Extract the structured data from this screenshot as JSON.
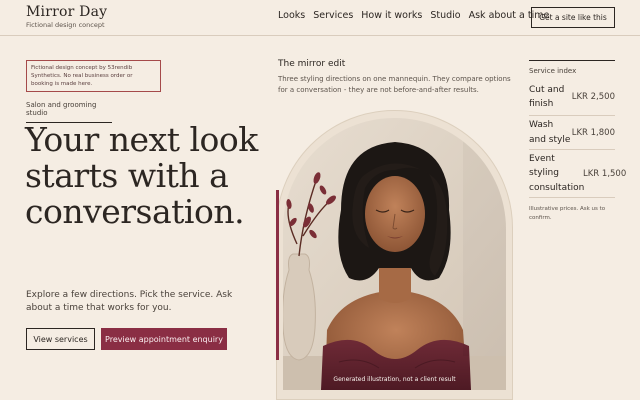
{
  "header": {
    "brand_name": "Mirror Day",
    "brand_sub": "Fictional design concept",
    "nav": [
      "Looks",
      "Services",
      "How it works",
      "Studio",
      "Ask about a time"
    ],
    "cta": "Get a site like this"
  },
  "hero": {
    "notice": "Fictional design concept by 53rendib Synthetics. No real business order or booking is made here.",
    "eyebrow": "Salon and grooming studio",
    "headline": "Your next look starts with a conversation.",
    "lede": "Explore a few directions. Pick the service. Ask about a time that works for you.",
    "btn_services": "View services",
    "btn_enquiry": "Preview appointment enquiry"
  },
  "mirror": {
    "title": "The mirror edit",
    "description": "Three styling directions on one mannequin. They compare options for a conversation - they are not before-and-after results.",
    "caption": "Generated illustration, not a client result"
  },
  "services": {
    "heading": "Service index",
    "items": [
      {
        "name": "Cut and finish",
        "price": "LKR 2,500"
      },
      {
        "name": "Wash and style",
        "price": "LKR 1,800"
      },
      {
        "name": "Event styling consultation",
        "price": "LKR 1,500"
      }
    ],
    "note": "Illustrative prices. Ask us to confirm."
  },
  "colors": {
    "background": "#f5ede3",
    "accent": "#8a2e44",
    "text": "#2c2622"
  }
}
